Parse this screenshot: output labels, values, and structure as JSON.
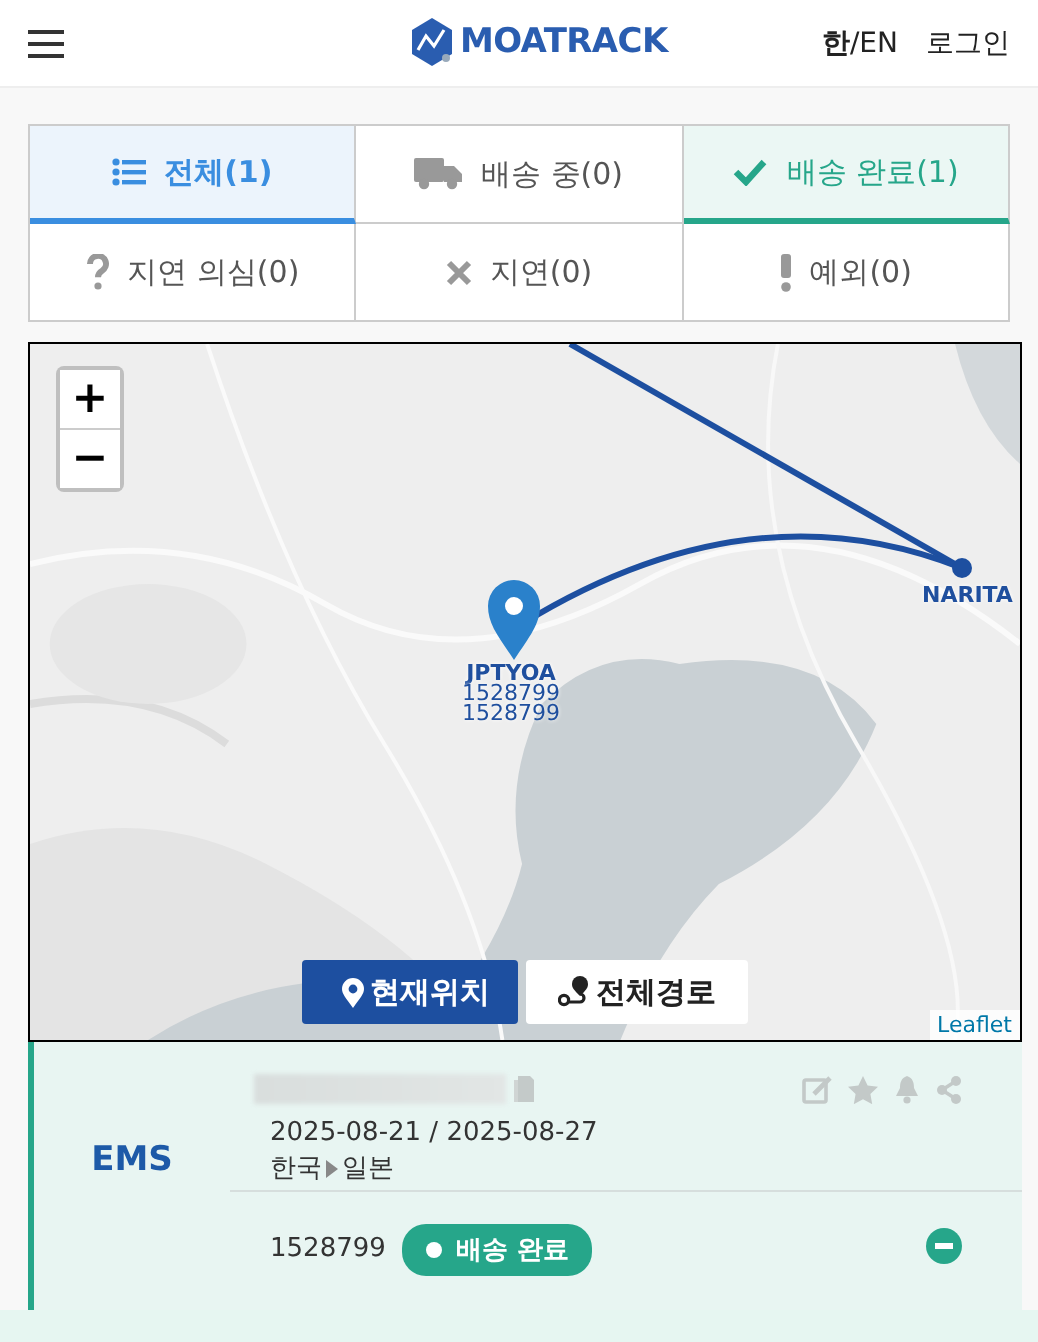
{
  "header": {
    "logo": "MOATRACK",
    "language": "**한**/EN",
    "login": "로그인"
  },
  "tabs": [
    {
      "label": "전체(1)",
      "kind": "list",
      "selected": true,
      "tinted": true,
      "color": "#3a8ee0"
    },
    {
      "label": "배송 중(0)",
      "kind": "truck",
      "selected": false,
      "tinted": false,
      "color": "#555555"
    },
    {
      "label": "배송 완료(1)",
      "kind": "check",
      "selected": false,
      "tinted": true,
      "color": "#26a68a"
    },
    {
      "label": "지연 의심(0)",
      "kind": "question",
      "selected": false,
      "tinted": false,
      "color": "#555555"
    },
    {
      "label": "지연(0)",
      "kind": "cross",
      "selected": false,
      "tinted": false,
      "color": "#555555"
    },
    {
      "label": "예외(0)",
      "kind": "exclamation",
      "selected": false,
      "tinted": false,
      "color": "#555555"
    }
  ],
  "map": {
    "zoom_in": "+",
    "zoom_out": "−",
    "markers": [
      {
        "kind": "pin",
        "label": "JPTYOA",
        "numbers": [
          "1528799",
          "1528799"
        ]
      },
      {
        "kind": "dot",
        "label": "NARITA"
      }
    ],
    "buttons": [
      {
        "label": "현재위치",
        "kind": "pin",
        "selected": true
      },
      {
        "label": "전체경로",
        "kind": "route",
        "selected": false
      }
    ],
    "attribution": "Leaflet"
  },
  "shipment": {
    "carrier": "EMS",
    "dates": "2025-08-21 / 2025-08-27",
    "origin": "한국",
    "destination": "일본",
    "tracking_number": "1528799",
    "status": "배송 완료",
    "expanded": true
  }
}
